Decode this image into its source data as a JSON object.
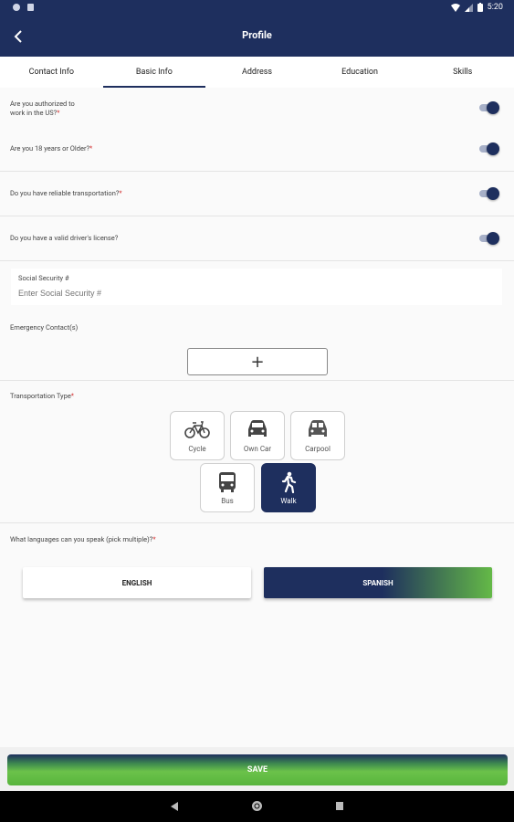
{
  "status": {
    "time": "5:20"
  },
  "appbar": {
    "title": "Profile"
  },
  "tabs": [
    {
      "label": "Contact Info"
    },
    {
      "label": "Basic Info"
    },
    {
      "label": "Address"
    },
    {
      "label": "Education"
    },
    {
      "label": "Skills"
    }
  ],
  "questions": [
    {
      "text": "Are you authorized to",
      "text2": "work in the US?",
      "required": "*",
      "value": true
    },
    {
      "text": "Are you 18 years or Older?",
      "required": "*",
      "value": true
    },
    {
      "text": "Do you have reliable transportation?",
      "required": "*",
      "value": true
    },
    {
      "text": "Do you have a valid driver's license?",
      "value": true
    }
  ],
  "ssn": {
    "label": "Social Security #",
    "placeholder": "Enter Social Security #",
    "value": ""
  },
  "emergency": {
    "label": "Emergency Contact(s)",
    "add_label": "+"
  },
  "transport": {
    "label": "Transportation Type",
    "required": "*",
    "options": [
      {
        "label": "Cycle",
        "icon": "bicycle-icon",
        "selected": false
      },
      {
        "label": "Own Car",
        "icon": "car-icon",
        "selected": false
      },
      {
        "label": "Carpool",
        "icon": "carpool-icon",
        "selected": false
      },
      {
        "label": "Bus",
        "icon": "bus-icon",
        "selected": false
      },
      {
        "label": "Walk",
        "icon": "walk-icon",
        "selected": true
      }
    ]
  },
  "languages": {
    "label": "What languages can you speak (pick multiple)?",
    "required": "*",
    "options": [
      {
        "label": "ENGLISH",
        "selected": false
      },
      {
        "label": "SPANISH",
        "selected": true
      }
    ]
  },
  "save": {
    "label": "SAVE"
  },
  "colors": {
    "primary": "#1e2f5e",
    "accent": "#64b947",
    "required": "#d32f2f"
  }
}
